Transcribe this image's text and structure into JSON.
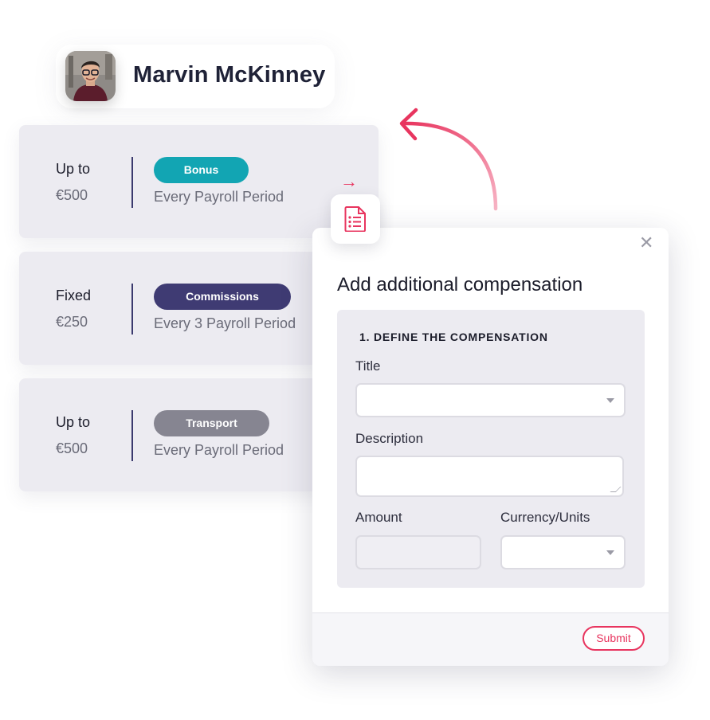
{
  "user": {
    "name": "Marvin McKinney"
  },
  "cards": [
    {
      "type": "Up to",
      "amount": "€500",
      "badge": "Bonus",
      "badge_color": "#12a5b3",
      "period": "Every Payroll Period"
    },
    {
      "type": "Fixed",
      "amount": "€250",
      "badge": "Commissions",
      "badge_color": "#3f3b73",
      "period": "Every 3 Payroll Period"
    },
    {
      "type": "Up to",
      "amount": "€500",
      "badge": "Transport",
      "badge_color": "#868591",
      "period": "Every Payroll Period"
    }
  ],
  "icons": {
    "arrow": "arrow-right-icon",
    "document": "document-list-icon",
    "close": "close-icon"
  },
  "arrow_glyph": "→",
  "modal": {
    "close_glyph": "✕",
    "title": "Add additional compensation",
    "section_title": "1. DEFINE THE COMPENSATION",
    "title_label": "Title",
    "title_value": "",
    "description_label": "Description",
    "description_value": "",
    "amount_label": "Amount",
    "amount_value": "",
    "currency_label": "Currency/Units",
    "currency_value": "",
    "submit_label": "Submit"
  },
  "colors": {
    "accent": "#e8355f",
    "panel": "#ecebf1",
    "divider": "#3b3a6e",
    "text_dark": "#1c1d2b",
    "text_muted": "#6a6b78"
  }
}
